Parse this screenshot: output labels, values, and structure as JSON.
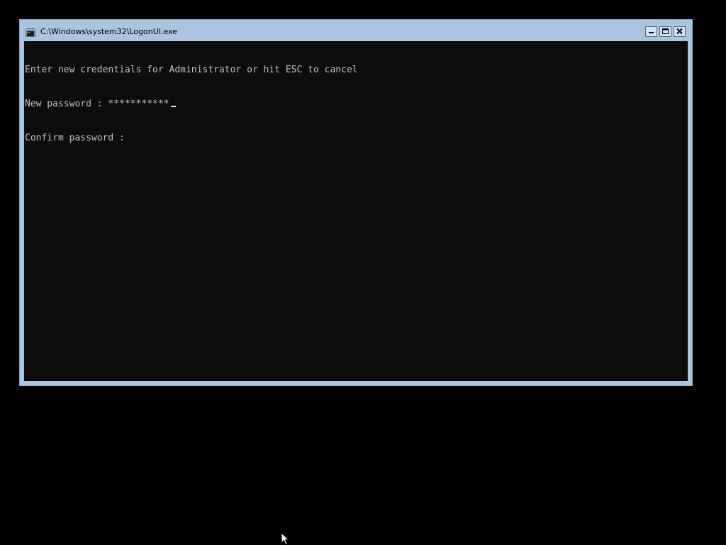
{
  "window": {
    "title": "C:\\Windows\\system32\\LogonUI.exe",
    "icon": "console-icon",
    "minimize_icon": "minimize-icon",
    "maximize_icon": "maximize-icon",
    "close_icon": "close-icon"
  },
  "console": {
    "prompt_line": "Enter new credentials for Administrator or hit ESC to cancel",
    "new_password_label": "New password : ",
    "new_password_value": "***********",
    "confirm_password_label": "Confirm password : ",
    "confirm_password_value": ""
  },
  "colors": {
    "desktop": "#000000",
    "window_frame": "#a9c4df",
    "console_background": "#0c0c0c",
    "console_text": "#c0c0c0"
  }
}
